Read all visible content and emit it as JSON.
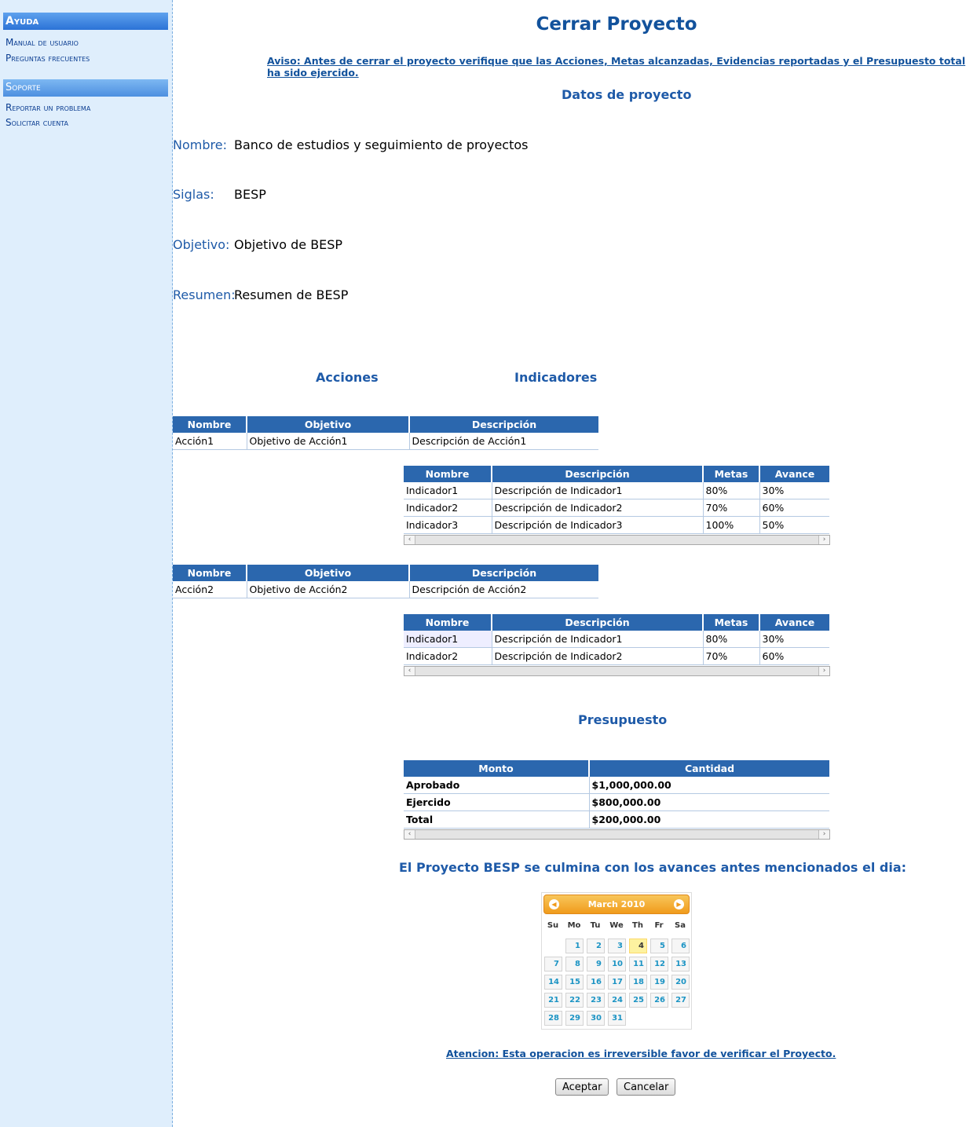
{
  "sidebar": {
    "ayuda": {
      "title": "Ayuda",
      "items": [
        "Manual de usuario",
        "Preguntas frecuentes"
      ]
    },
    "soporte": {
      "title": "Soporte",
      "items": [
        "Reportar un problema",
        "Solicitar cuenta"
      ]
    }
  },
  "page": {
    "title": "Cerrar Proyecto",
    "warning": "Aviso: Antes de cerrar el proyecto verifique que las Acciones, Metas alcanzadas, Evidencias reportadas y el Presupuesto total ha sido ejercido.",
    "datos_heading": "Datos de proyecto"
  },
  "project": {
    "nombre_label": "Nombre:",
    "nombre": "Banco de estudios y seguimiento de proyectos",
    "siglas_label": "Siglas:",
    "siglas": "BESP",
    "objetivo_label": "Objetivo:",
    "objetivo": "Objetivo de BESP",
    "resumen_label": "Resumen:",
    "resumen": "Resumen de BESP"
  },
  "sections": {
    "acciones": "Acciones",
    "indicadores": "Indicadores",
    "presupuesto": "Presupuesto"
  },
  "accion_headers": [
    "Nombre",
    "Objetivo",
    "Descripción"
  ],
  "indicador_headers": [
    "Nombre",
    "Descripción",
    "Metas",
    "Avance"
  ],
  "acciones": [
    {
      "row": [
        "Acción1",
        "Objetivo de Acción1",
        "Descripción de Acción1"
      ],
      "indicadores": [
        [
          "Indicador1",
          "Descripción de Indicador1",
          "80%",
          "30%"
        ],
        [
          "Indicador2",
          "Descripción de Indicador2",
          "70%",
          "60%"
        ],
        [
          "Indicador3",
          "Descripción de Indicador3",
          "100%",
          "50%"
        ]
      ]
    },
    {
      "row": [
        "Acción2",
        "Objetivo de Acción2",
        "Descripción de Acción2"
      ],
      "indicadores": [
        [
          "Indicador1",
          "Descripción de Indicador1",
          "80%",
          "30%"
        ],
        [
          "Indicador2",
          "Descripción de Indicador2",
          "70%",
          "60%"
        ]
      ]
    }
  ],
  "presupuesto": {
    "headers": [
      "Monto",
      "Cantidad"
    ],
    "rows": [
      [
        "Aprobado",
        "$1,000,000.00"
      ],
      [
        "Ejercido",
        "$800,000.00"
      ],
      [
        "Total",
        "$200,000.00"
      ]
    ]
  },
  "culmina_text": "El Proyecto BESP se culmina con los avances antes mencionados el dia:",
  "calendar": {
    "month_label": "March 2010",
    "weekdays": [
      "Su",
      "Mo",
      "Tu",
      "We",
      "Th",
      "Fr",
      "Sa"
    ],
    "weeks": [
      [
        "",
        "1",
        "2",
        "3",
        "4",
        "5",
        "6"
      ],
      [
        "7",
        "8",
        "9",
        "10",
        "11",
        "12",
        "13"
      ],
      [
        "14",
        "15",
        "16",
        "17",
        "18",
        "19",
        "20"
      ],
      [
        "21",
        "22",
        "23",
        "24",
        "25",
        "26",
        "27"
      ],
      [
        "28",
        "29",
        "30",
        "31",
        "",
        "",
        ""
      ]
    ],
    "today": "4",
    "colors": {
      "header": "#f09b1c",
      "day_text": "#1c94c4",
      "today_bg": "#fdf2a0"
    }
  },
  "atencion": "Atencion: Esta operacion es irreversible favor de verificar el Proyecto.",
  "buttons": {
    "aceptar": "Aceptar",
    "cancelar": "Cancelar"
  }
}
